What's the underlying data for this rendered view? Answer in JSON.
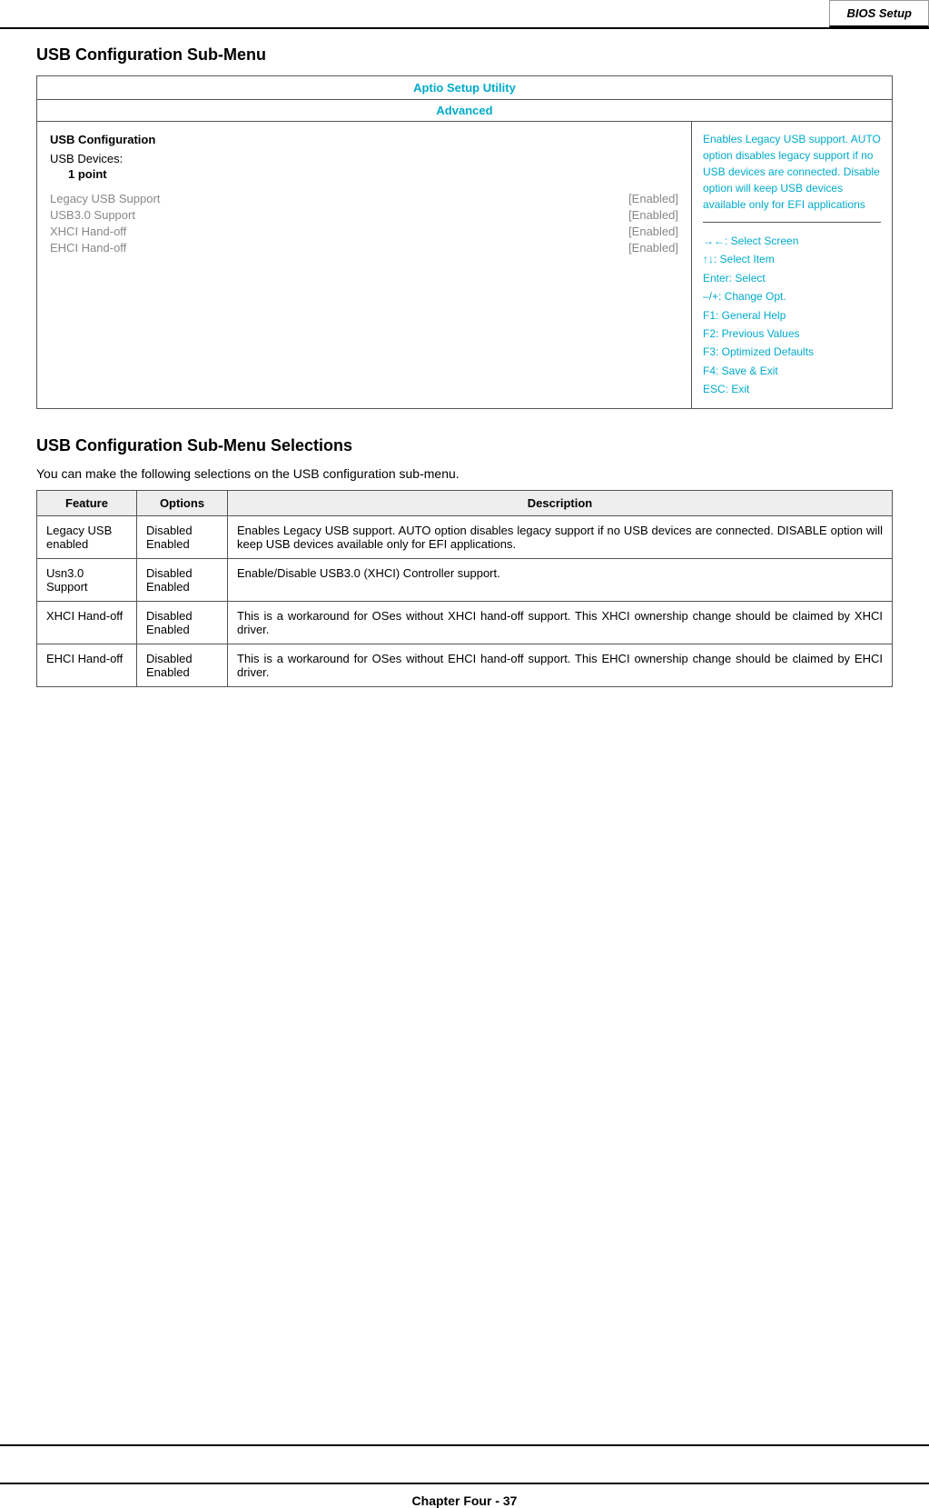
{
  "header": {
    "tab_label": "BIOS Setup"
  },
  "section1": {
    "title": "USB Configuration Sub-Menu",
    "bios_header": "Aptio Setup Utility",
    "bios_subheader": "Advanced",
    "left_panel": {
      "section_label": "USB Configuration",
      "devices_label": "USB Devices:",
      "devices_value": "1 point",
      "settings": [
        {
          "name": "Legacy USB Support",
          "value": "[Enabled]",
          "active": false
        },
        {
          "name": "USB3.0 Support",
          "value": "[Enabled]",
          "active": false
        },
        {
          "name": "XHCI Hand-off",
          "value": "[Enabled]",
          "active": false
        },
        {
          "name": "EHCI Hand-off",
          "value": "[Enabled]",
          "active": false
        }
      ]
    },
    "right_panel": {
      "help_text": "Enables  Legacy  USB support.\nAUTO option disables legacy support if no USB devices are connected. Disable option will keep USB devices available only for EFI applications",
      "nav_items": [
        "→←: Select Screen",
        "↑↓: Select Item",
        "Enter: Select",
        "–/+: Change Opt.",
        "F1: General Help",
        "F2: Previous Values",
        "F3: Optimized Defaults",
        "F4: Save & Exit",
        "ESC: Exit"
      ]
    }
  },
  "section2": {
    "title": "USB Configuration Sub-Menu Selections",
    "description": "You can make the following selections on the USB configuration sub-menu.",
    "table": {
      "headers": [
        "Feature",
        "Options",
        "Description"
      ],
      "rows": [
        {
          "feature": "Legacy  USB enabled",
          "options": "Disabled\nEnabled",
          "description": "Enables  Legacy  USB  support. AUTO  option  disables  legacy support  if  no  USB  devices  are connected.  DISABLE  option  will keep  USB  devices  available  only for EFI applications."
        },
        {
          "feature": "Usn3.0 Support",
          "options": "Disabled\nEnabled",
          "description": "Enable/Disable  USB3.0  (XHCI) Controller support."
        },
        {
          "feature": "XHCI Hand-off",
          "options": "Disabled\nEnabled",
          "description": "This  is  a  workaround  for  OSes without  XHCI  hand-off  support. This  XHCI  ownership  change should  be  claimed  by  XHCI driver."
        },
        {
          "feature": "EHCI Hand-off",
          "options": "Disabled\nEnabled",
          "description": "This  is  a  workaround  for  OSes without  EHCI  hand-off  support. This  EHCI  ownership  change should  be  claimed  by  EHCI driver."
        }
      ]
    }
  },
  "footer": {
    "label": "Chapter Four - 37"
  }
}
